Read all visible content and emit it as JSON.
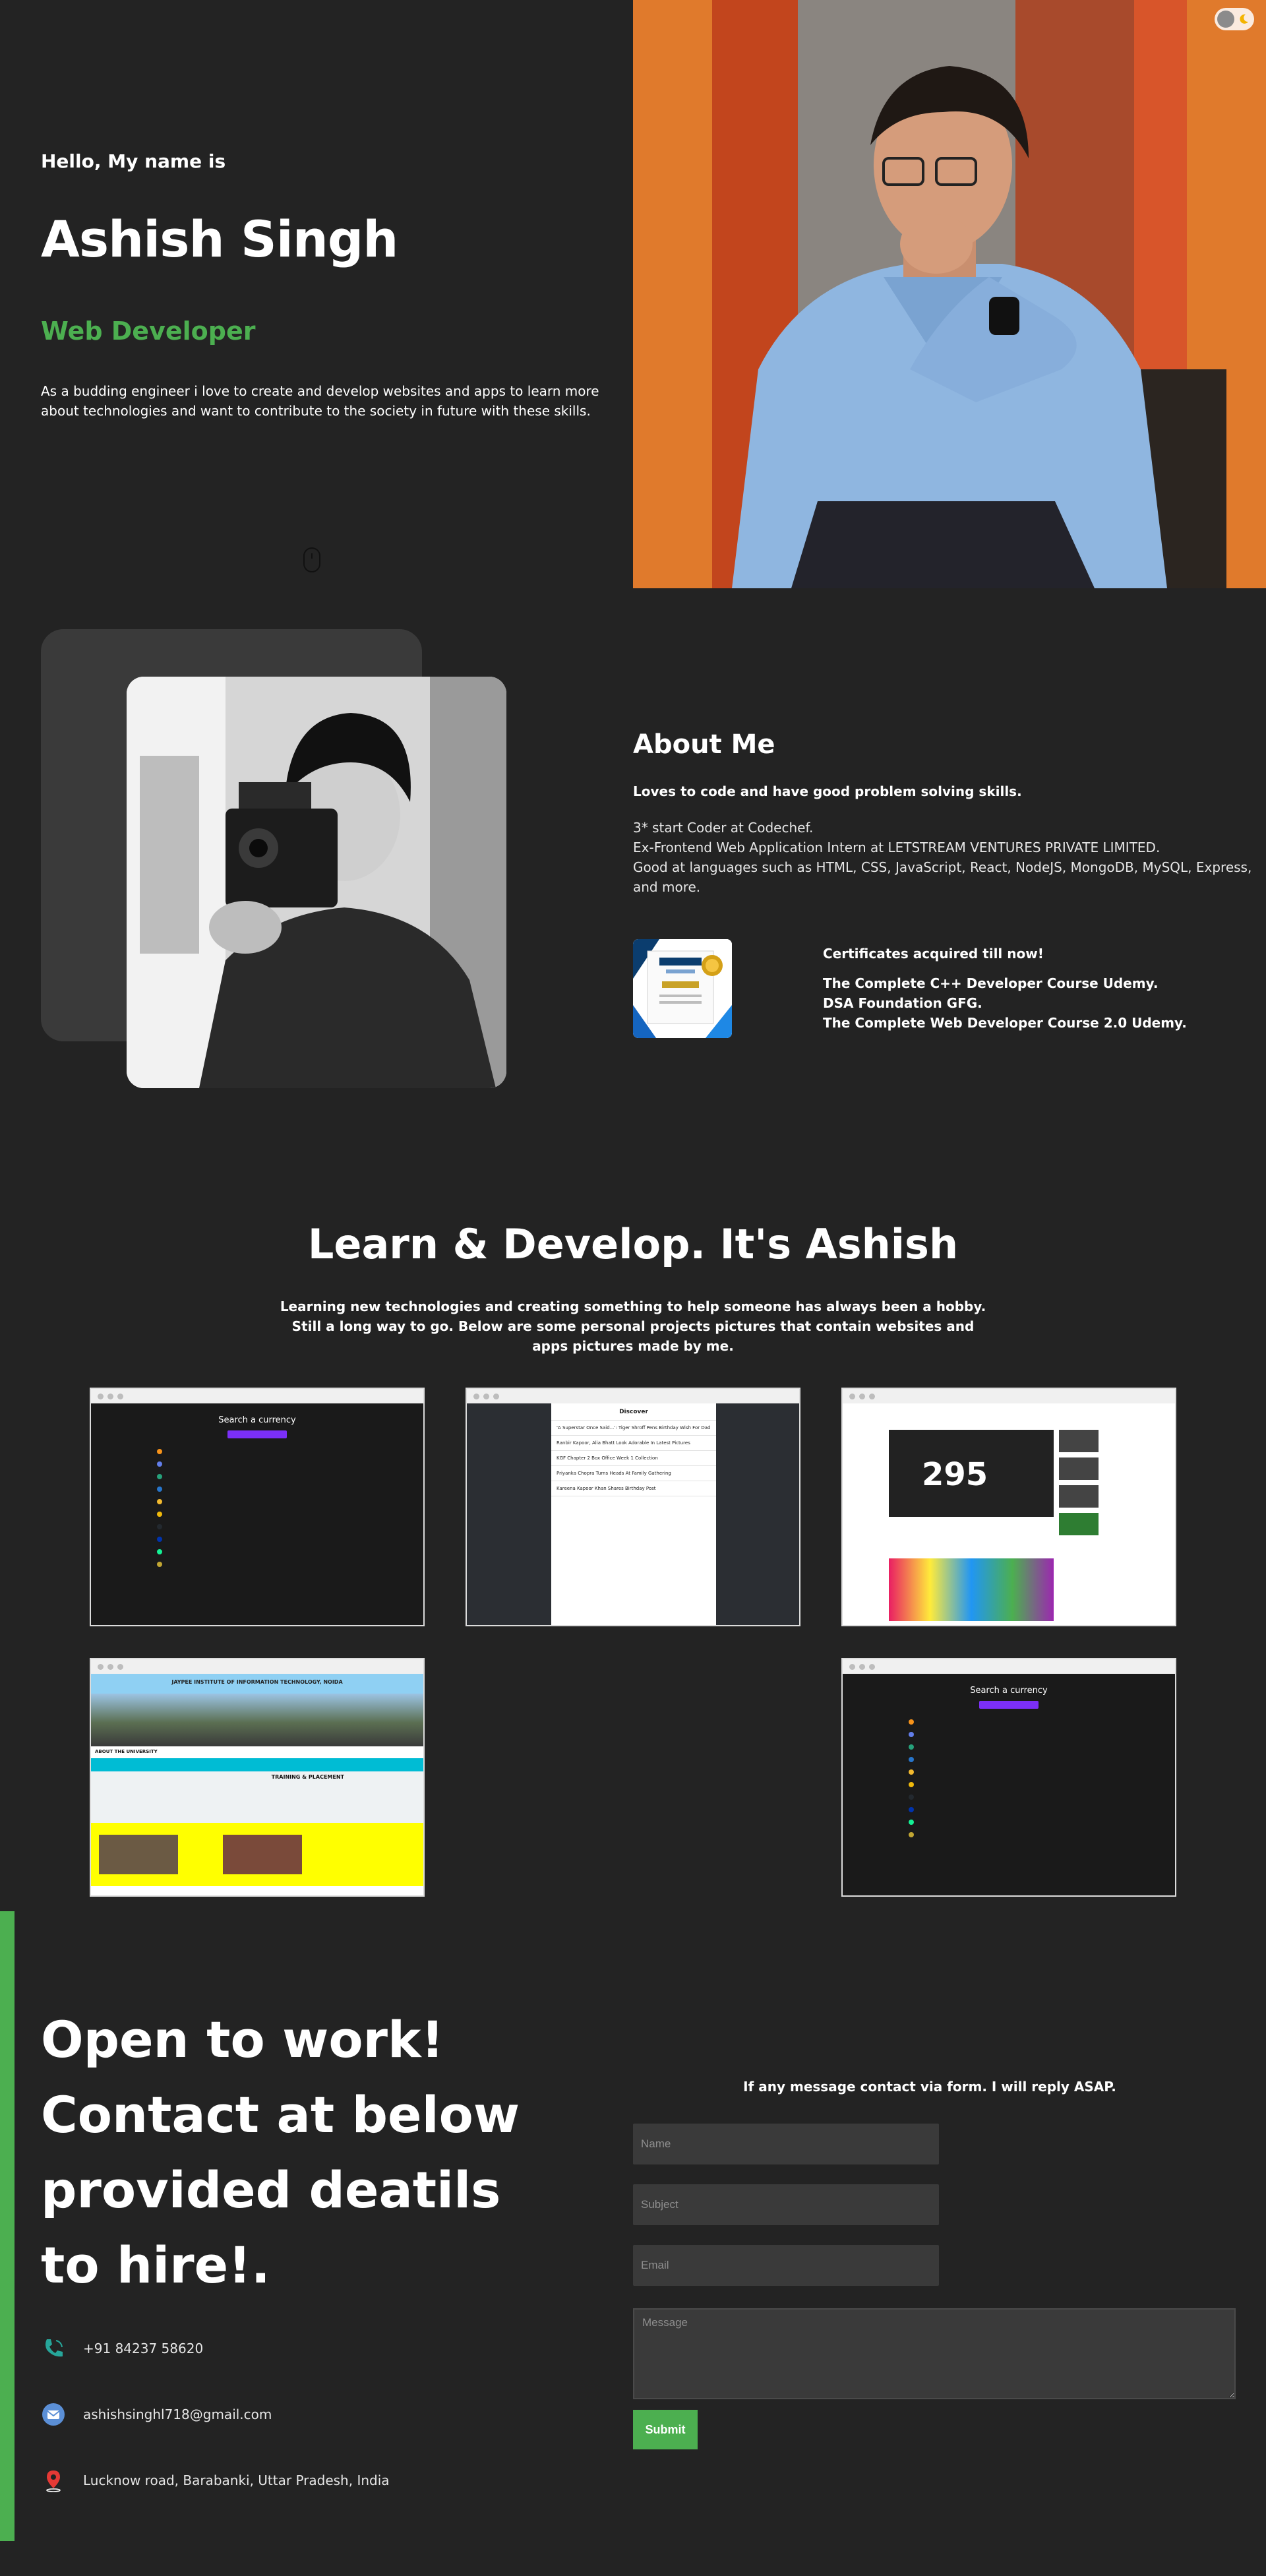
{
  "hero": {
    "greeting": "Hello, My name is",
    "name": "Ashish Singh",
    "role": "Web Developer",
    "description": "As a budding engineer i love to create and develop websites and apps to learn more about technologies and want to contribute to the society in future with these skills.",
    "accent_color": "#4caf50"
  },
  "about": {
    "title": "About Me",
    "lead": "Loves to code and have good problem solving skills.",
    "lines": [
      "3* start Coder at Codechef.",
      "Ex-Frontend Web Application Intern at LETSTREAM VENTURES PRIVATE LIMITED.",
      "Good at languages such as HTML, CSS, JavaScript, React, NodeJS, MongoDB, MySQL, Express, and more."
    ],
    "certificates_title": "Certificates acquired till now!",
    "certificates": [
      "The Complete C++ Developer Course Udemy.",
      "DSA Foundation GFG.",
      "The Complete Web Developer Course 2.0 Udemy."
    ]
  },
  "projects": {
    "title": "Learn & Develop. It's Ashish",
    "description": "Learning new technologies and creating something to help someone has always been a hobby. Still a long way to go. Below are some personal projects pictures that contain websites and apps pictures made by me.",
    "crypto_title": "Search a currency",
    "news_app_title": "Discover",
    "news_headlines": [
      "'A Superstar Once Said...': Tiger Shroff Pens Birthday Wish For Dad",
      "Ranbir Kapoor, Alia Bhatt Look Adorable In Latest Pictures",
      "KGF Chapter 2 Box Office Week 1 Collection",
      "Priyanka Chopra Turns Heads At Family Gathering",
      "Kareena Kapoor Khan Shares Birthday Post"
    ],
    "youtube_big_text": "295",
    "jaypee_header": "JAYPEE INSTITUTE OF INFORMATION TECHNOLOGY, NOIDA",
    "jaypee_section": "ABOUT THE UNIVERSITY",
    "jaypee_training": "TRAINING & PLACEMENT"
  },
  "contact": {
    "heading": "Open to work! Contact at below provided deatils to hire!.",
    "phone": "+91 84237 58620",
    "email": "ashishsinghl718@gmail.com",
    "address": "Lucknow road, Barabanki, Uttar Pradesh, India",
    "form_note": "If any message contact via form. I will reply ASAP.",
    "placeholders": {
      "name": "Name",
      "subject": "Subject",
      "email": "Email",
      "message": "Message"
    },
    "submit_label": "Submit"
  },
  "icons": [
    "theme-toggle-icon",
    "mouse-scroll-icon",
    "phone-icon",
    "mail-icon",
    "location-pin-icon"
  ]
}
